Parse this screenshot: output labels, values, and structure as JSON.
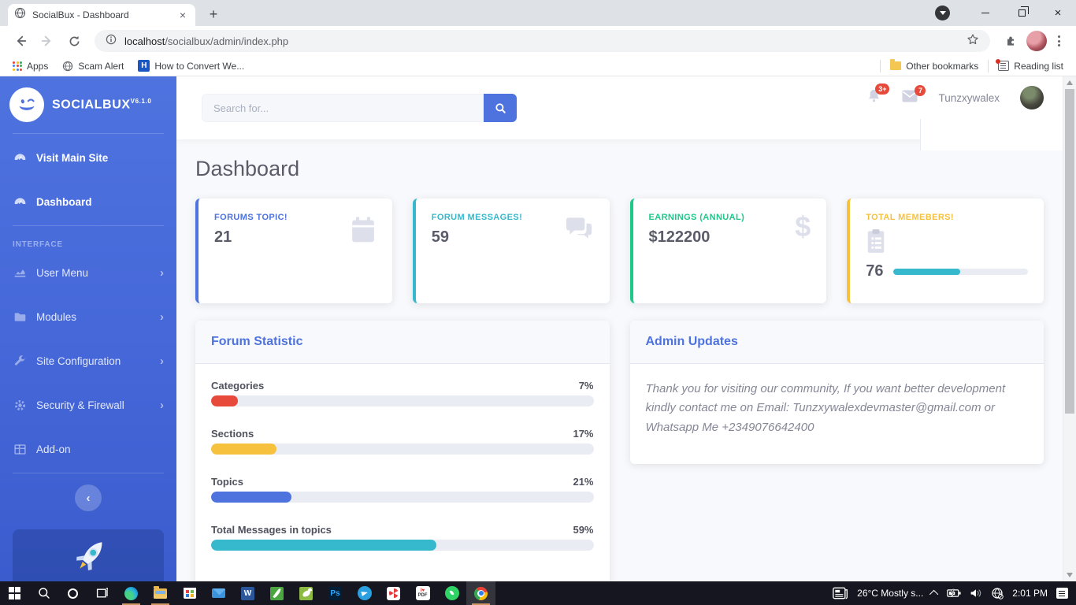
{
  "browser": {
    "tab_title": "SocialBux - Dashboard",
    "url_host": "localhost",
    "url_path": "/socialbux/admin/index.php",
    "bookmarks": {
      "apps": "Apps",
      "scam_alert": "Scam Alert",
      "how_to_convert": "How to Convert We...",
      "other_bookmarks": "Other bookmarks",
      "reading_list": "Reading list"
    }
  },
  "sidebar": {
    "brand": "SOCIALBUX",
    "version": "V6.1.0",
    "items": [
      {
        "label": "Visit Main Site"
      },
      {
        "label": "Dashboard"
      }
    ],
    "section_heading": "INTERFACE",
    "interface_items": [
      {
        "label": "User Menu"
      },
      {
        "label": "Modules"
      },
      {
        "label": "Site Configuration"
      },
      {
        "label": "Security & Firewall"
      },
      {
        "label": "Add-on"
      }
    ]
  },
  "topbar": {
    "search_placeholder": "Search for...",
    "alerts_badge": "3+",
    "messages_badge": "7",
    "username": "Tunzxywalex"
  },
  "main": {
    "title": "Dashboard",
    "cards": [
      {
        "label": "FORUMS TOPIC!",
        "value": "21",
        "accent": "#4e73df"
      },
      {
        "label": "FORUM MESSAGES!",
        "value": "59",
        "accent": "#36b9cc"
      },
      {
        "label": "EARNINGS (ANNUAL)",
        "value": "$122200",
        "accent": "#1cc88a"
      },
      {
        "label": "TOTAL MEMEBERS!",
        "value": "76",
        "accent": "#f6c23e",
        "progress_pct": 50,
        "progress_color": "#36b9cc"
      }
    ],
    "forum_statistic": {
      "title": "Forum Statistic",
      "items": [
        {
          "label": "Categories",
          "percent": 7,
          "percent_label": "7%",
          "color": "#e74a3b"
        },
        {
          "label": "Sections",
          "percent": 17,
          "percent_label": "17%",
          "color": "#f6c23e"
        },
        {
          "label": "Topics",
          "percent": 21,
          "percent_label": "21%",
          "color": "#4e73df"
        },
        {
          "label": "Total Messages in topics",
          "percent": 59,
          "percent_label": "59%",
          "color": "#36b9cc"
        }
      ]
    },
    "admin_updates": {
      "title": "Admin Updates",
      "text": "Thank you for visiting our community, If you want better development kindly contact me on Email: Tunzxywalexdevmaster@gmail.com or Whatsapp Me +2349076642400"
    }
  },
  "taskbar": {
    "weather": "26°C Mostly s...",
    "time": "2:01 PM"
  },
  "colors": {
    "primary": "#4e73df",
    "danger_badge": "#e74a3b",
    "progress_track": "#eaecf4"
  },
  "icons": {
    "chevron_right": "›",
    "chevron_left": "‹",
    "close_glyph": "×",
    "plus_glyph": "+",
    "dollar_glyph": "$",
    "word_glyph": "W",
    "ps_glyph": "Ps",
    "bookmark_h_glyph": "H",
    "ilovepdf_top": "I♥",
    "ilovepdf_bottom": "PDF"
  }
}
